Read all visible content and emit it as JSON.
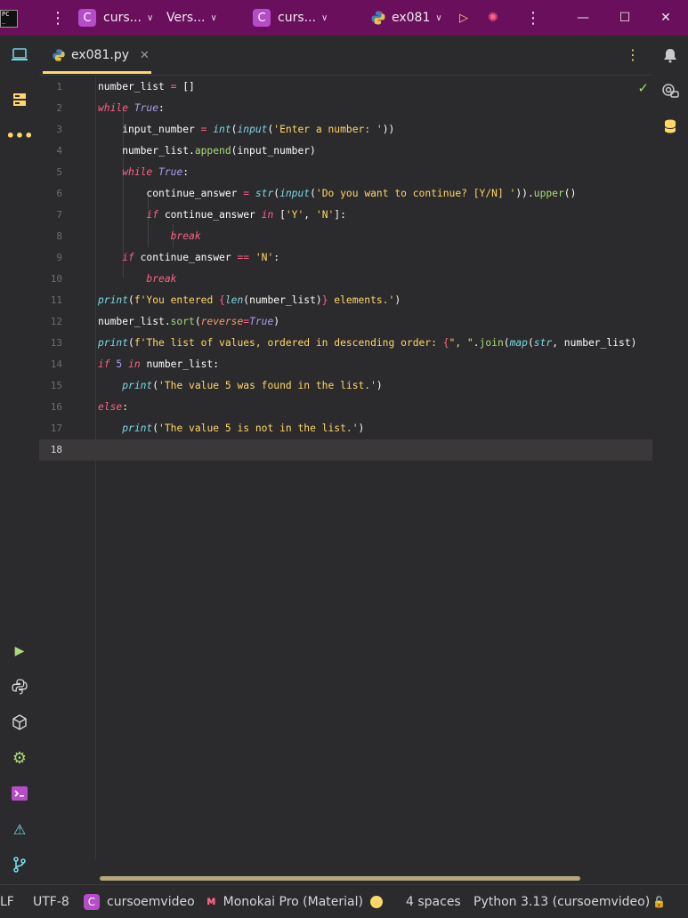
{
  "titlebar": {
    "logo_text": "PC",
    "project1_icon": "C",
    "project1_label": "curs...",
    "vcs_label": "Vers...",
    "project2_icon": "C",
    "project2_label": "curs...",
    "run_config_label": "ex081"
  },
  "tab": {
    "filename": "ex081.py"
  },
  "editor": {
    "line_numbers": [
      "1",
      "2",
      "3",
      "4",
      "5",
      "6",
      "7",
      "8",
      "9",
      "10",
      "11",
      "12",
      "13",
      "14",
      "15",
      "16",
      "17",
      "18"
    ],
    "current_line": "18"
  },
  "statusbar": {
    "line_sep": "LF",
    "encoding": "UTF-8",
    "project_icon": "C",
    "project": "cursoemvideo",
    "theme": "Monokai Pro (Material)",
    "indent": "4 spaces",
    "interpreter": "Python 3.13 (cursoemvideo)"
  },
  "colors": {
    "titlebar": "#6a0f5c",
    "accent": "#ffd866",
    "keyword": "#ff6188",
    "builtin": "#78dce8",
    "string": "#ffd866",
    "number": "#ab9df2",
    "method": "#a9dc76"
  },
  "icons": {
    "left_strip": [
      "project-icon",
      "structure-icon",
      "more-icon",
      "run-icon",
      "python-console-icon",
      "python-packages-icon",
      "services-icon",
      "terminal-icon",
      "problems-icon",
      "git-icon"
    ],
    "right_strip": [
      "notifications-icon",
      "ai-assistant-icon",
      "database-icon"
    ]
  }
}
